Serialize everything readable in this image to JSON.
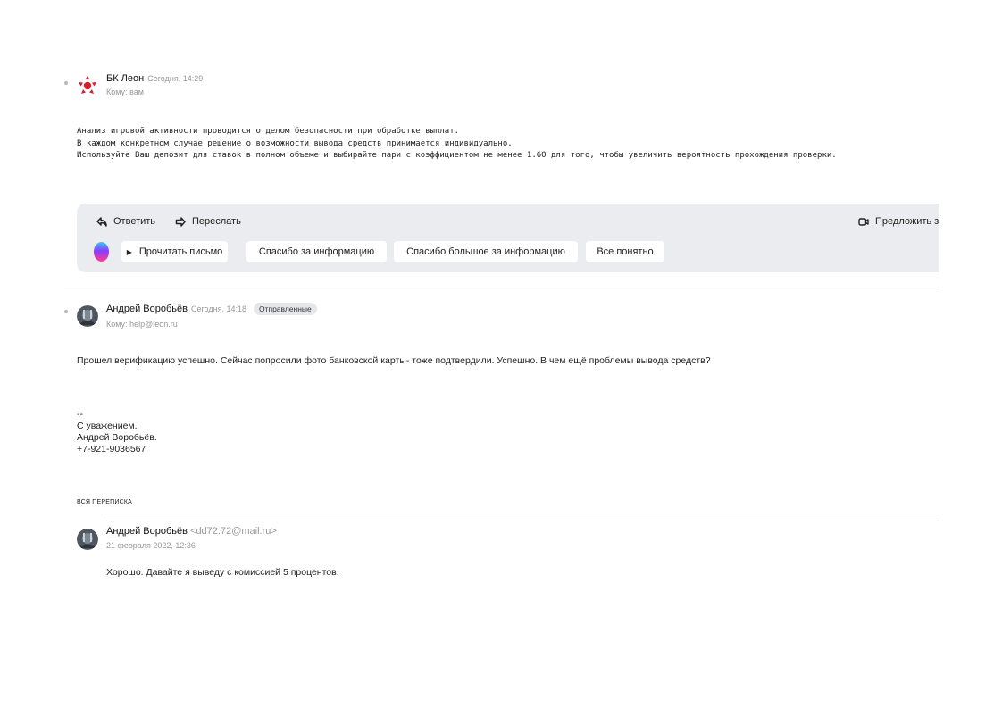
{
  "message1": {
    "sender": "БК Леон",
    "time": "Сегодня, 14:29",
    "to_label": "Кому:",
    "to_value": "вам",
    "body": [
      "Анализ игровой активности проводится отделом безопасности при обработке выплат.",
      "В каждом конкретном случае решение о возможности вывода средств принимается индивидуально.",
      "Используйте Ваш депозит для ставок в полном объеме и выбирайте пари с коэффициентом не менее 1.60 для того, чтобы увеличить вероятность прохождения проверки."
    ]
  },
  "toolbar": {
    "reply_label": "Ответить",
    "forward_label": "Переслать",
    "suggest_label": "Предложить з",
    "read_label": "Прочитать письмо",
    "quick_replies": [
      "Спасибо за информацию",
      "Спасибо большое за информацию",
      "Все понятно"
    ]
  },
  "message2": {
    "sender": "Андрей Воробьёв",
    "time": "Сегодня, 14:18",
    "folder_badge": "Отправленные",
    "to_label": "Кому:",
    "to_value": "help@leon.ru",
    "body": "Прошел верификацию успешно. Сейчас попросили фото банковской карты- тоже подтвердили. Успешно. В чем ещё проблемы вывода средств?",
    "signature": [
      "--",
      "С уважением.",
      "Андрей Воробьёв.",
      "+7-921-9036567"
    ]
  },
  "thread": {
    "label": "ВСЯ ПЕРЕПИСКА",
    "sender": "Андрей Воробьёв",
    "email": "<dd72.72@mail.ru>",
    "date": "21 февраля 2022, 12:36",
    "body": "Хорошо. Давайте я выведу с комиссией 5 процентов."
  },
  "colors": {
    "leon_red": "#d8202c",
    "toolbar_bg": "#ebecef",
    "badge_bg": "#e6e7ea"
  }
}
